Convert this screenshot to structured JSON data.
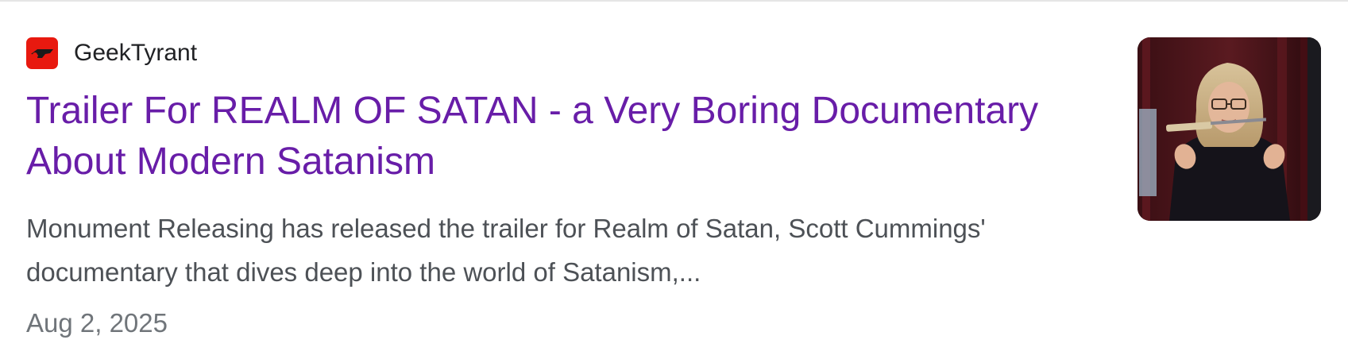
{
  "result": {
    "source": {
      "name": "GeekTyrant",
      "favicon_icon": "geektyrant-logo-icon",
      "favicon_color": "#e8190f"
    },
    "title": "Trailer For REALM OF SATAN - a Very Boring Documentary About Modern Satanism",
    "snippet": "Monument Releasing has released the trailer for Realm of Satan, Scott Cummings' documentary that dives deep into the world of Satanism,...",
    "date": "Aug 2, 2025",
    "thumbnail_icon": "thumbnail-image",
    "colors": {
      "title_visited": "#681da8",
      "snippet_text": "#4d5156",
      "date_text": "#70757a",
      "source_text": "#202124"
    }
  }
}
